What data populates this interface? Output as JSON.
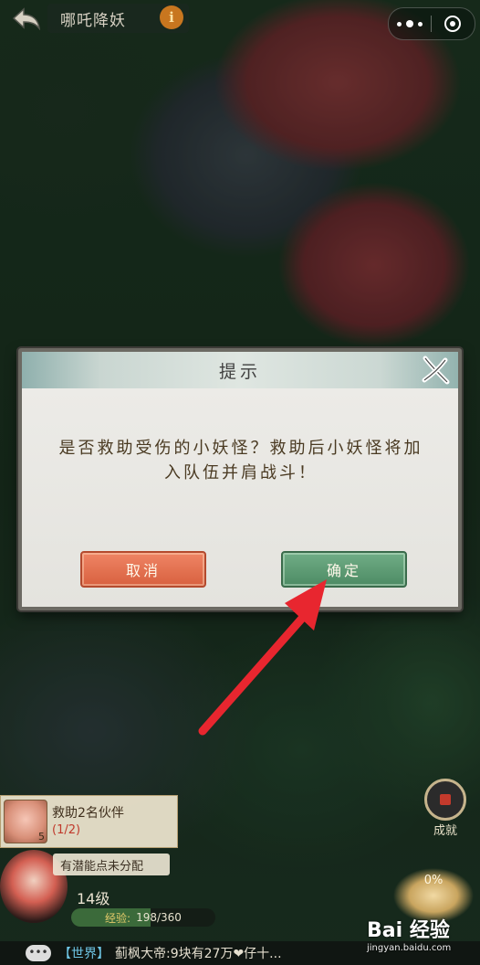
{
  "topbar": {
    "back_icon": "back-arrow-icon",
    "title": "哪吒降妖",
    "info_symbol": "i",
    "more_icon": "more-dots-icon",
    "close_icon": "capsule-close-icon"
  },
  "dialog": {
    "title": "提示",
    "close_icon": "brush-close-icon",
    "message": "是否救助受伤的小妖怪？救助后小妖怪将加入队伍并肩战斗！",
    "cancel_label": "取消",
    "confirm_label": "确定"
  },
  "annotation": {
    "arrow_color": "#e8262f",
    "arrow_icon": "red-arrow-pointing-to-confirm"
  },
  "hud": {
    "rescue_title": "救助2名伙伴",
    "rescue_progress": "(1/2)",
    "rescue_count": "5",
    "skill_tip": "有潜能点未分配",
    "level": "14级",
    "exp_label": "经验:",
    "exp_value": "198/360",
    "exp_fraction": 0.55,
    "achievement_label": "成就",
    "lotus_percent": "0%"
  },
  "chat": {
    "icon_text": "•••",
    "channel": "【世界】",
    "message": "蓟枫大帝:9块有27万❤仔十..."
  },
  "watermark": {
    "logo": "Bai 经验",
    "url": "jingyan.baidu.com"
  },
  "colors": {
    "cancel": "#d8603f",
    "confirm": "#4d8b64",
    "dialog_text": "#4a3a22",
    "chat_channel": "#6fc6e6"
  }
}
